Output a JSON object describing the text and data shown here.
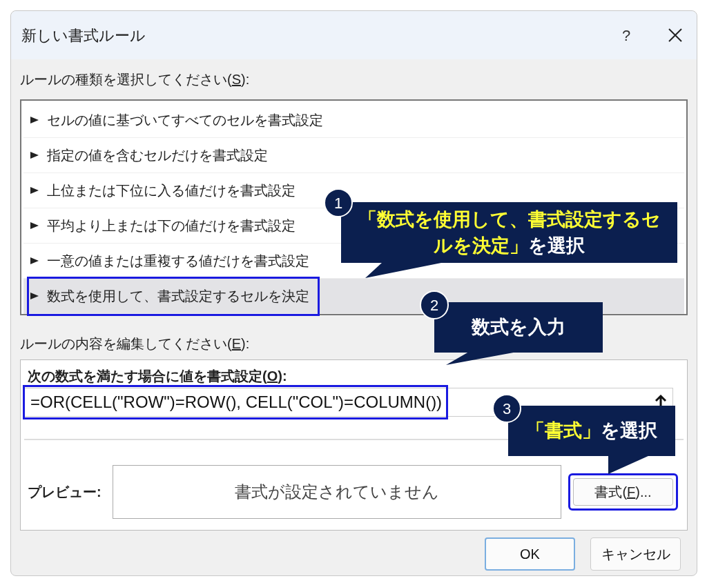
{
  "window": {
    "title": "新しい書式ルール",
    "help": "?"
  },
  "rule_type_label": {
    "text": "ルールの種類を選択してください(",
    "key": "S",
    "suffix": "):"
  },
  "rule_types": [
    {
      "label": "セルの値に基づいてすべてのセルを書式設定",
      "selected": false,
      "highlighted": false
    },
    {
      "label": "指定の値を含むセルだけを書式設定",
      "selected": false,
      "highlighted": false
    },
    {
      "label": "上位または下位に入る値だけを書式設定",
      "selected": false,
      "highlighted": false
    },
    {
      "label": "平均より上または下の値だけを書式設定",
      "selected": false,
      "highlighted": false
    },
    {
      "label": "一意の値または重複する値だけを書式設定",
      "selected": false,
      "highlighted": false
    },
    {
      "label": "数式を使用して、書式設定するセルを決定",
      "selected": true,
      "highlighted": true
    }
  ],
  "edit_label": {
    "text": "ルールの内容を編集してください(",
    "key": "E",
    "suffix": "):"
  },
  "formula_label": {
    "text": "次の数式を満たす場合に値を書式設定(",
    "key": "O",
    "suffix": "):"
  },
  "formula": {
    "value": "=OR(CELL(\"ROW\")=ROW(), CELL(\"COL\")=COLUMN())",
    "highlighted": true
  },
  "preview": {
    "label": "プレビュー:",
    "text": "書式が設定されていません"
  },
  "format_button": {
    "text": "書式(",
    "key": "F",
    "suffix": ")...",
    "highlighted": true
  },
  "buttons": [
    {
      "label": "OK",
      "default": true
    },
    {
      "label": "キャンセル",
      "default": false
    }
  ],
  "callouts": [
    {
      "number": "1",
      "segments": [
        {
          "text": "「数式を使用して、書式設定するセルを決定」",
          "highlight": true
        },
        {
          "text": "を選択",
          "highlight": false
        }
      ]
    },
    {
      "number": "2",
      "segments": [
        {
          "text": "数式を入力",
          "highlight": false
        }
      ]
    },
    {
      "number": "3",
      "segments": [
        {
          "text": "「書式」",
          "highlight": true
        },
        {
          "text": "を選択",
          "highlight": false
        }
      ]
    }
  ]
}
